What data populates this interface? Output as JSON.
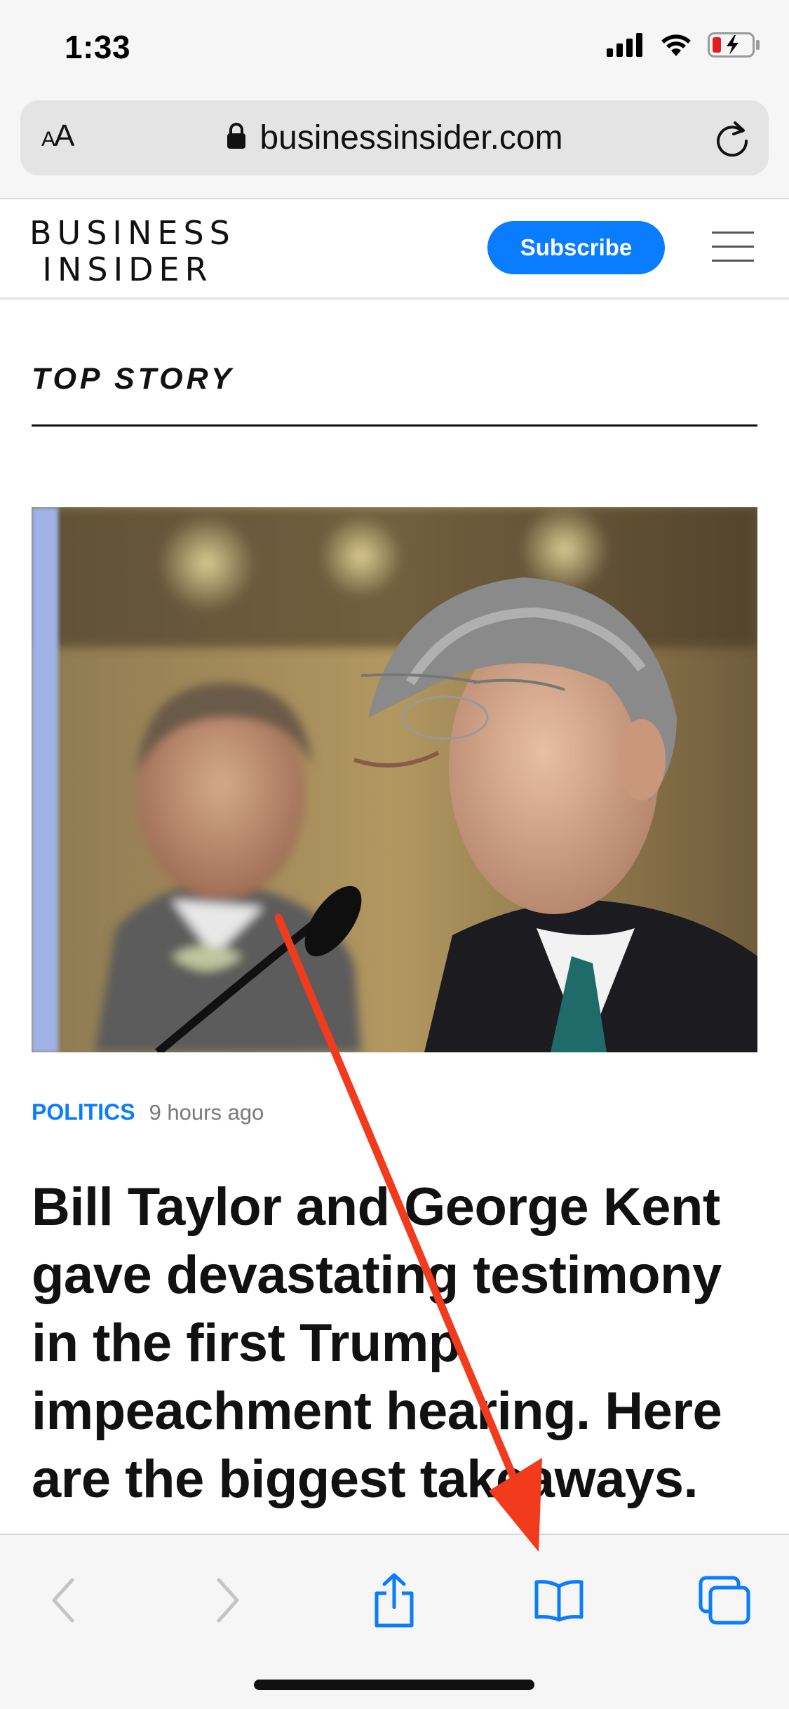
{
  "status_bar": {
    "time": "1:33"
  },
  "browser": {
    "text_size_label_small": "A",
    "text_size_label_large": "A",
    "url": "businessinsider.com"
  },
  "site": {
    "logo_line1": "BUSINESS",
    "logo_line2": "INSIDER",
    "subscribe_label": "Subscribe"
  },
  "article": {
    "section_label": "TOP STORY",
    "category": "POLITICS",
    "timestamp": "9 hours ago",
    "headline": "Bill Taylor and George Kent gave devastating testimony in the first Trump impeachment hearing. Here are the biggest takeaways."
  },
  "toolbar": {
    "items": [
      "back",
      "forward",
      "share",
      "bookmarks",
      "tabs"
    ]
  },
  "icons": {
    "status": [
      "cellular-signal-icon",
      "wifi-icon",
      "battery-charging-icon"
    ],
    "browser": [
      "lock-icon",
      "reload-icon"
    ],
    "toolbar": [
      "chevron-left-icon",
      "chevron-right-icon",
      "share-icon",
      "book-icon",
      "tabs-icon"
    ]
  },
  "colors": {
    "accent": "#0a7cff",
    "annotation": "#f23a1d",
    "battery_low": "#e02020"
  }
}
